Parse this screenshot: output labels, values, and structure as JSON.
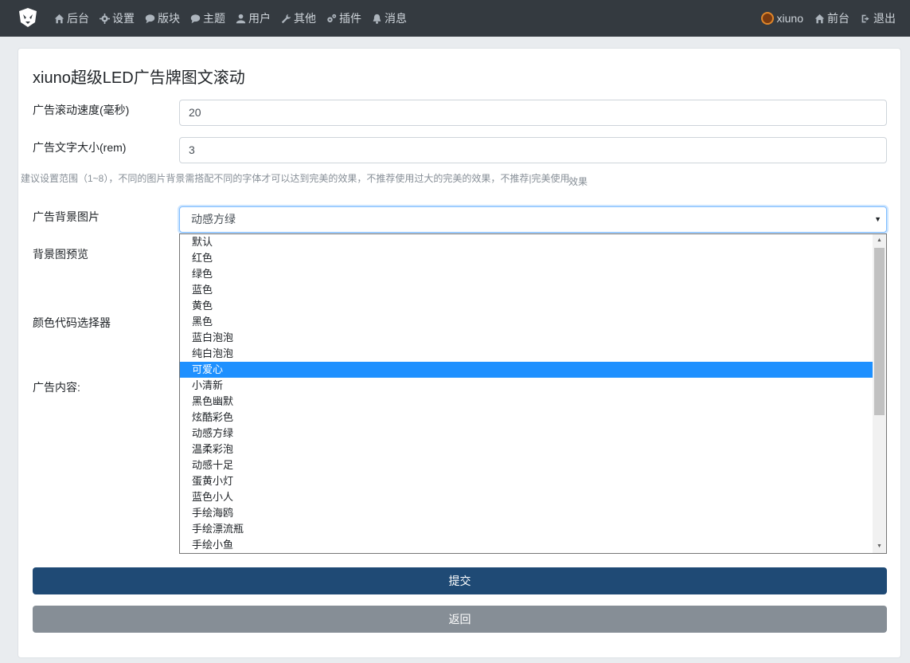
{
  "navbar": {
    "left_items": [
      {
        "label": "后台",
        "icon": "home-icon"
      },
      {
        "label": "设置",
        "icon": "gear-icon"
      },
      {
        "label": "版块",
        "icon": "comment-icon"
      },
      {
        "label": "主题",
        "icon": "comment-icon"
      },
      {
        "label": "用户",
        "icon": "user-icon"
      },
      {
        "label": "其他",
        "icon": "wrench-icon"
      },
      {
        "label": "插件",
        "icon": "cogs-icon"
      },
      {
        "label": "消息",
        "icon": "bell-icon"
      }
    ],
    "user": "xiuno",
    "front_label": "前台",
    "logout_label": "退出"
  },
  "card": {
    "title": "xiuno超级LED广告牌图文滚动",
    "speed_label": "广告滚动速度(毫秒)",
    "speed_value": "20",
    "size_label": "广告文字大小(rem)",
    "size_value": "3",
    "hint": "建议设置范围（1~8），不同的图片背景需搭配不同的字体才可以达到完美的效果，不推荐使用过大的完美的效果，不推荐|完美使用",
    "hint_tail": "效果",
    "bg_label": "广告背景图片",
    "bg_selected": "动感方绿",
    "preview_label": "背景图预览",
    "color_label": "颜色代码选择器",
    "content_label": "广告内容:",
    "options": [
      "默认",
      "红色",
      "绿色",
      "蓝色",
      "黄色",
      "黑色",
      "蓝白泡泡",
      "纯白泡泡",
      "可爱心",
      "小清新",
      "黑色幽默",
      "炫酷彩色",
      "动感方绿",
      "温柔彩泡",
      "动感十足",
      "蛋黄小灯",
      "蓝色小人",
      "手绘海鸥",
      "手绘漂流瓶",
      "手绘小鱼"
    ],
    "highlighted_index": 8,
    "submit_label": "提交",
    "back_label": "返回"
  },
  "colors": {
    "navbar_bg": "#343a40",
    "primary_button": "#1f4a75",
    "secondary_button": "#868e96",
    "highlight": "#1e90ff"
  }
}
